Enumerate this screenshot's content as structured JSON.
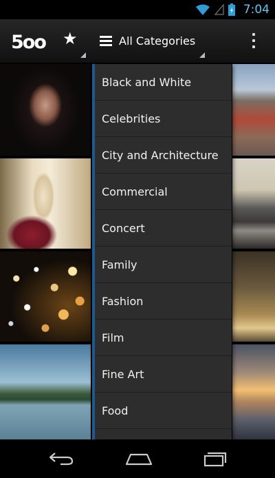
{
  "status_bar": {
    "time": "7:04",
    "icons": [
      "wifi-icon",
      "signal-icon",
      "battery-icon"
    ],
    "time_color": "#5ec8f0"
  },
  "action_bar": {
    "logo": "5oo",
    "favorites_icon": "star-icon",
    "category_spinner": {
      "icon": "list-icon",
      "label": "All Categories"
    },
    "overflow_icon": "overflow-menu-icon"
  },
  "category_dropdown": {
    "accent_color": "#1a5c92",
    "items": [
      "Black and White",
      "Celebrities",
      "City and Architecture",
      "Commercial",
      "Concert",
      "Family",
      "Fashion",
      "Film",
      "Fine Art",
      "Food"
    ]
  },
  "photo_grid": {
    "thumbnails": [
      "portrait-photo",
      "bride-photo",
      "bokeh-lights-photo",
      "lake-photo",
      "city-photo",
      "bridge-photo",
      "tree-photo",
      "sunset-photo"
    ]
  },
  "nav_bar": {
    "icons": [
      "back-icon",
      "home-icon",
      "recent-apps-icon"
    ]
  }
}
